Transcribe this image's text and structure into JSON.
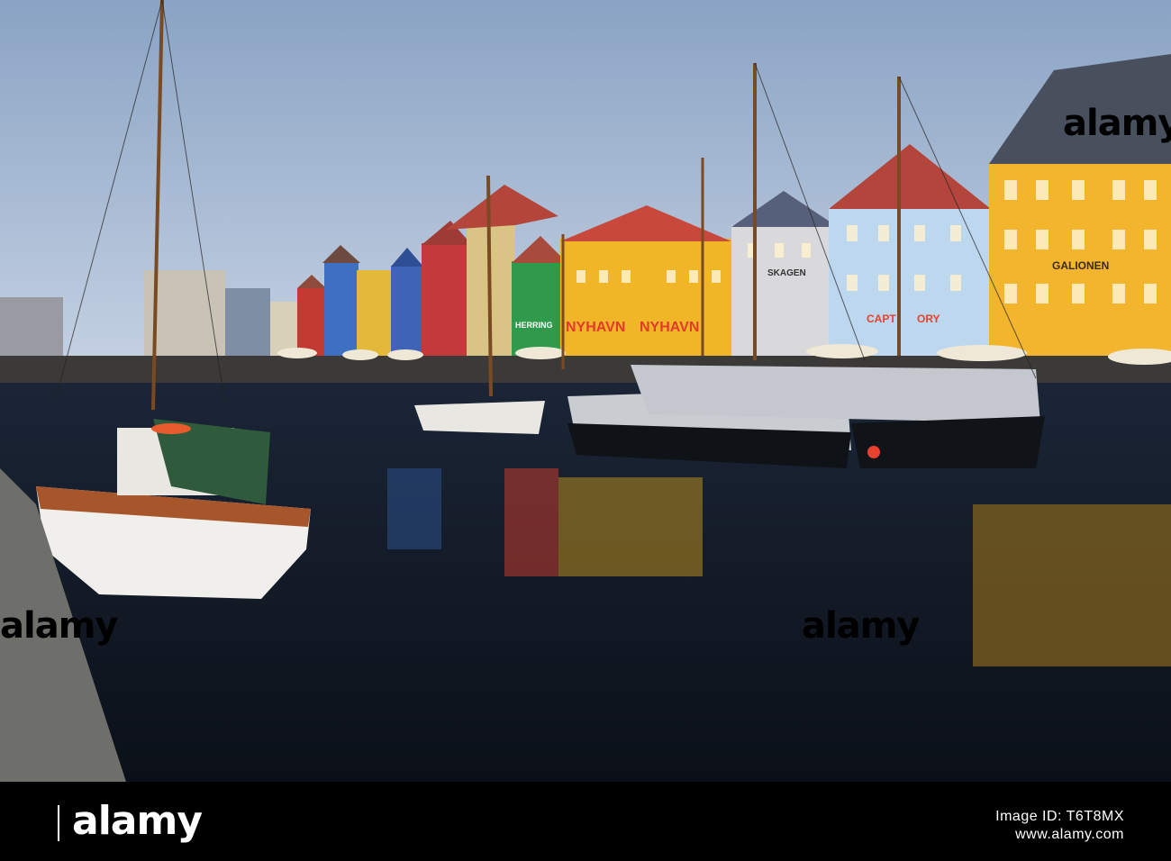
{
  "photo": {
    "signs": {
      "nyhavn_left": "NYHAVN",
      "nyhavn_right": "NYHAVN",
      "herring": "HERRING",
      "skagen": "SKAGEN",
      "galionen": "GALIONEN",
      "capt": "CAPT",
      "ory": "ORY"
    },
    "watermark": "alamy"
  },
  "footer": {
    "brand": "alamy",
    "image_id": "Image ID: T6T8MX",
    "site": "www.alamy.com"
  }
}
